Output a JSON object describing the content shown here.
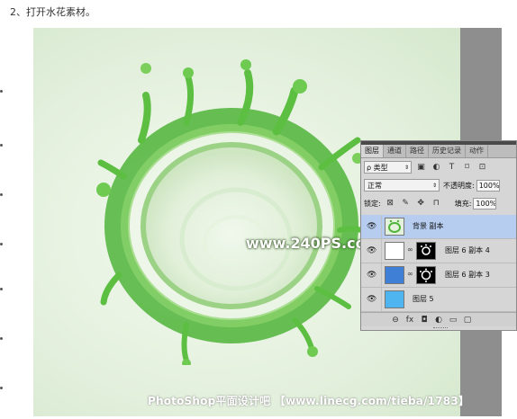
{
  "article": {
    "step_title": "2、打开水花素材。"
  },
  "canvas": {
    "watermark": "www.240PS.com",
    "credit": "PhotoShop平面设计吧 【www.linecg.com/tieba/1783】"
  },
  "layers_panel": {
    "tabs": [
      "图层",
      "通道",
      "路径",
      "历史记录",
      "动作"
    ],
    "filter": {
      "label": "ρ 类型",
      "arrows": "⇕"
    },
    "filter_icons": [
      "image-filter-icon",
      "adjustment-filter-icon",
      "type-filter-icon",
      "shape-filter-icon",
      "smart-object-filter-icon"
    ],
    "blend_mode": "正常",
    "opacity_label": "不透明度:",
    "opacity_value": "100%",
    "lock_label": "锁定:",
    "fill_label": "填充:",
    "fill_value": "100%",
    "layers": [
      {
        "name": "背景 副本",
        "selected": true,
        "visible": true,
        "thumb": "splash"
      },
      {
        "name": "图层 6 副本 4",
        "selected": false,
        "visible": true,
        "thumb": "white",
        "mask": true
      },
      {
        "name": "图层 6 副本 3",
        "selected": false,
        "visible": true,
        "thumb": "#3f7fd6",
        "mask": true
      },
      {
        "name": "图层 5",
        "selected": false,
        "visible": true,
        "thumb": "#4fb5f0"
      }
    ],
    "footer_icons": [
      "link-icon",
      "fx-icon",
      "layer-mask-icon",
      "adjustment-layer-icon",
      "new-group-icon",
      "new-layer-icon"
    ],
    "footer_glyphs": [
      "⊖",
      "fx",
      "◘",
      "◐",
      "▭",
      "▢"
    ]
  }
}
